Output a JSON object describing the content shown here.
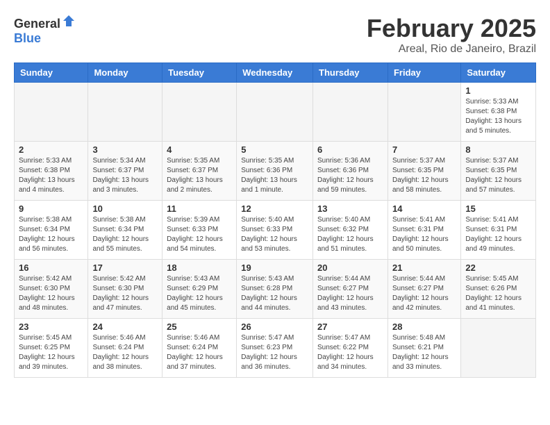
{
  "logo": {
    "text_general": "General",
    "text_blue": "Blue"
  },
  "header": {
    "title": "February 2025",
    "subtitle": "Areal, Rio de Janeiro, Brazil"
  },
  "weekdays": [
    "Sunday",
    "Monday",
    "Tuesday",
    "Wednesday",
    "Thursday",
    "Friday",
    "Saturday"
  ],
  "weeks": [
    [
      {
        "day": "",
        "info": ""
      },
      {
        "day": "",
        "info": ""
      },
      {
        "day": "",
        "info": ""
      },
      {
        "day": "",
        "info": ""
      },
      {
        "day": "",
        "info": ""
      },
      {
        "day": "",
        "info": ""
      },
      {
        "day": "1",
        "info": "Sunrise: 5:33 AM\nSunset: 6:38 PM\nDaylight: 13 hours and 5 minutes."
      }
    ],
    [
      {
        "day": "2",
        "info": "Sunrise: 5:33 AM\nSunset: 6:38 PM\nDaylight: 13 hours and 4 minutes."
      },
      {
        "day": "3",
        "info": "Sunrise: 5:34 AM\nSunset: 6:37 PM\nDaylight: 13 hours and 3 minutes."
      },
      {
        "day": "4",
        "info": "Sunrise: 5:35 AM\nSunset: 6:37 PM\nDaylight: 13 hours and 2 minutes."
      },
      {
        "day": "5",
        "info": "Sunrise: 5:35 AM\nSunset: 6:36 PM\nDaylight: 13 hours and 1 minute."
      },
      {
        "day": "6",
        "info": "Sunrise: 5:36 AM\nSunset: 6:36 PM\nDaylight: 12 hours and 59 minutes."
      },
      {
        "day": "7",
        "info": "Sunrise: 5:37 AM\nSunset: 6:35 PM\nDaylight: 12 hours and 58 minutes."
      },
      {
        "day": "8",
        "info": "Sunrise: 5:37 AM\nSunset: 6:35 PM\nDaylight: 12 hours and 57 minutes."
      }
    ],
    [
      {
        "day": "9",
        "info": "Sunrise: 5:38 AM\nSunset: 6:34 PM\nDaylight: 12 hours and 56 minutes."
      },
      {
        "day": "10",
        "info": "Sunrise: 5:38 AM\nSunset: 6:34 PM\nDaylight: 12 hours and 55 minutes."
      },
      {
        "day": "11",
        "info": "Sunrise: 5:39 AM\nSunset: 6:33 PM\nDaylight: 12 hours and 54 minutes."
      },
      {
        "day": "12",
        "info": "Sunrise: 5:40 AM\nSunset: 6:33 PM\nDaylight: 12 hours and 53 minutes."
      },
      {
        "day": "13",
        "info": "Sunrise: 5:40 AM\nSunset: 6:32 PM\nDaylight: 12 hours and 51 minutes."
      },
      {
        "day": "14",
        "info": "Sunrise: 5:41 AM\nSunset: 6:31 PM\nDaylight: 12 hours and 50 minutes."
      },
      {
        "day": "15",
        "info": "Sunrise: 5:41 AM\nSunset: 6:31 PM\nDaylight: 12 hours and 49 minutes."
      }
    ],
    [
      {
        "day": "16",
        "info": "Sunrise: 5:42 AM\nSunset: 6:30 PM\nDaylight: 12 hours and 48 minutes."
      },
      {
        "day": "17",
        "info": "Sunrise: 5:42 AM\nSunset: 6:30 PM\nDaylight: 12 hours and 47 minutes."
      },
      {
        "day": "18",
        "info": "Sunrise: 5:43 AM\nSunset: 6:29 PM\nDaylight: 12 hours and 45 minutes."
      },
      {
        "day": "19",
        "info": "Sunrise: 5:43 AM\nSunset: 6:28 PM\nDaylight: 12 hours and 44 minutes."
      },
      {
        "day": "20",
        "info": "Sunrise: 5:44 AM\nSunset: 6:27 PM\nDaylight: 12 hours and 43 minutes."
      },
      {
        "day": "21",
        "info": "Sunrise: 5:44 AM\nSunset: 6:27 PM\nDaylight: 12 hours and 42 minutes."
      },
      {
        "day": "22",
        "info": "Sunrise: 5:45 AM\nSunset: 6:26 PM\nDaylight: 12 hours and 41 minutes."
      }
    ],
    [
      {
        "day": "23",
        "info": "Sunrise: 5:45 AM\nSunset: 6:25 PM\nDaylight: 12 hours and 39 minutes."
      },
      {
        "day": "24",
        "info": "Sunrise: 5:46 AM\nSunset: 6:24 PM\nDaylight: 12 hours and 38 minutes."
      },
      {
        "day": "25",
        "info": "Sunrise: 5:46 AM\nSunset: 6:24 PM\nDaylight: 12 hours and 37 minutes."
      },
      {
        "day": "26",
        "info": "Sunrise: 5:47 AM\nSunset: 6:23 PM\nDaylight: 12 hours and 36 minutes."
      },
      {
        "day": "27",
        "info": "Sunrise: 5:47 AM\nSunset: 6:22 PM\nDaylight: 12 hours and 34 minutes."
      },
      {
        "day": "28",
        "info": "Sunrise: 5:48 AM\nSunset: 6:21 PM\nDaylight: 12 hours and 33 minutes."
      },
      {
        "day": "",
        "info": ""
      }
    ]
  ]
}
